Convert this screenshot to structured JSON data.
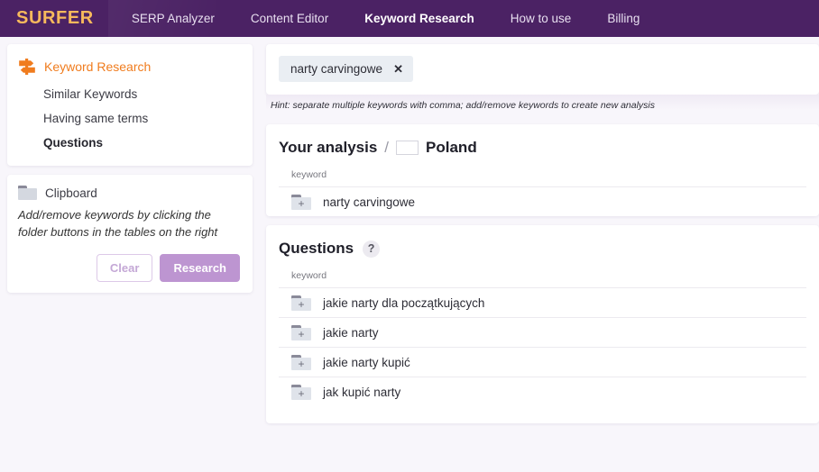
{
  "navbar": {
    "logo": "SURFER",
    "items": [
      {
        "label": "SERP Analyzer",
        "active": false
      },
      {
        "label": "Content Editor",
        "active": false
      },
      {
        "label": "Keyword Research",
        "active": true
      },
      {
        "label": "How to use",
        "active": false
      },
      {
        "label": "Billing",
        "active": false
      }
    ],
    "bg_color": "#4b2264",
    "logo_color": "#f7b95c"
  },
  "sidebar": {
    "menu_head": {
      "label": "Keyword Research",
      "icon": "signpost-icon",
      "color": "#f07c1e"
    },
    "items": [
      {
        "label": "Similar Keywords",
        "active": false
      },
      {
        "label": "Having same terms",
        "active": false
      },
      {
        "label": "Questions",
        "active": true
      }
    ],
    "clipboard": {
      "icon": "folder-icon",
      "label": "Clipboard",
      "description": "Add/remove keywords by clicking the folder buttons in the tables on the right",
      "clear_label": "Clear",
      "research_label": "Research",
      "research_color": "#bd95d1"
    }
  },
  "main": {
    "keyword_input": {
      "chips": [
        {
          "label": "narty carvingowe",
          "remove_icon": "close-icon"
        }
      ],
      "hint": "Hint: separate multiple keywords with comma; add/remove keywords to create new analysis"
    },
    "analysis": {
      "title": "Your analysis",
      "separator": "/",
      "country": "Poland",
      "flag": "poland-flag",
      "column_header": "keyword",
      "rows": [
        {
          "keyword": "narty carvingowe",
          "icon": "folder-plus-icon"
        }
      ]
    },
    "questions": {
      "title": "Questions",
      "help_icon": "?",
      "column_header": "keyword",
      "rows": [
        {
          "keyword": "jakie narty dla początkujących",
          "icon": "folder-plus-icon"
        },
        {
          "keyword": "jakie narty",
          "icon": "folder-plus-icon"
        },
        {
          "keyword": "jakie narty kupić",
          "icon": "folder-plus-icon"
        },
        {
          "keyword": "jak kupić narty",
          "icon": "folder-plus-icon"
        }
      ]
    }
  }
}
